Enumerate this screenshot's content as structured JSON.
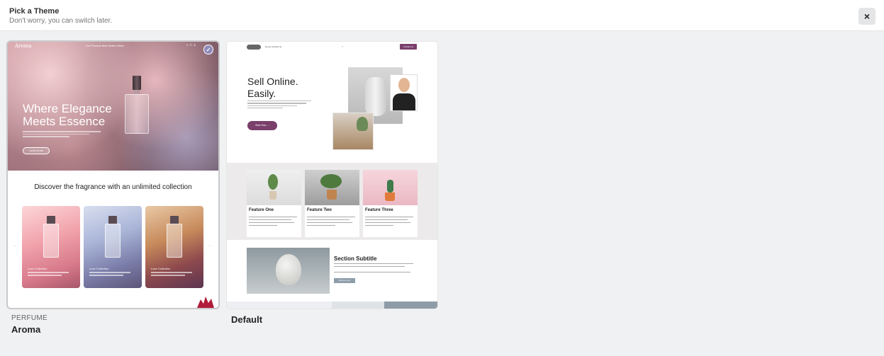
{
  "header": {
    "title": "Pick a Theme",
    "subtitle": "Don't worry, you can switch later.",
    "close_symbol": "×"
  },
  "themes": [
    {
      "category": "PERFUME",
      "name": "Aroma",
      "selected": true,
      "preview": {
        "logo": "Aroma",
        "nav_links": "Our Products        Best Sellers        Offers",
        "headline": "Where Elegance Meets Essence",
        "cta": "LEARN MORE",
        "section_heading": "Discover the fragrance with an unlimited collection",
        "products": [
          {
            "tag": "Luxe Collection"
          },
          {
            "tag": "Luxe Collection"
          },
          {
            "tag": "Luxe Collection"
          }
        ]
      }
    },
    {
      "category": "",
      "name": "Default",
      "selected": false,
      "preview": {
        "menu": "Home   Contact us",
        "cta": "Contact Us",
        "search_symbol": "⌕",
        "headline": "Sell Online. Easily.",
        "start_button": "Start Now →",
        "features": [
          {
            "title": "Feature One"
          },
          {
            "title": "Feature Two"
          },
          {
            "title": "Feature Three"
          }
        ],
        "section_subtitle": "Section Subtitle",
        "section_button": "Discover more"
      }
    }
  ],
  "colors": {
    "accent_purple": "#7a3f6a",
    "check_badge": "#8f8ab9"
  },
  "icons": {
    "close": "close-icon",
    "selected": "check-icon"
  }
}
